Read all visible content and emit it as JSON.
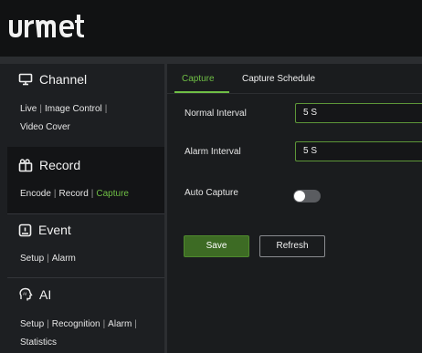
{
  "brand": {
    "logo_text": "urmet"
  },
  "sidebar": {
    "channel": {
      "title": "Channel",
      "icon": "monitor-icon",
      "links": [
        "Live",
        "Image Control",
        "Video Cover"
      ]
    },
    "record": {
      "title": "Record",
      "icon": "record-icon",
      "links": [
        "Encode",
        "Record",
        "Capture"
      ],
      "active": "Capture"
    },
    "event": {
      "title": "Event",
      "icon": "event-alert-icon",
      "links": [
        "Setup",
        "Alarm"
      ]
    },
    "ai": {
      "title": "AI",
      "icon": "ai-icon",
      "links": [
        "Setup",
        "Recognition",
        "Alarm",
        "Statistics"
      ]
    }
  },
  "tabs": {
    "active": "Capture",
    "items": [
      "Capture",
      "Capture Schedule"
    ]
  },
  "form": {
    "normal_interval": {
      "label": "Normal Interval",
      "value": "5 S"
    },
    "alarm_interval": {
      "label": "Alarm Interval",
      "value": "5 S"
    },
    "auto_capture": {
      "label": "Auto Capture",
      "enabled": false
    }
  },
  "buttons": {
    "save": "Save",
    "refresh": "Refresh"
  },
  "colors": {
    "accent": "#6fbf45",
    "save_bg": "#3d6b24"
  }
}
